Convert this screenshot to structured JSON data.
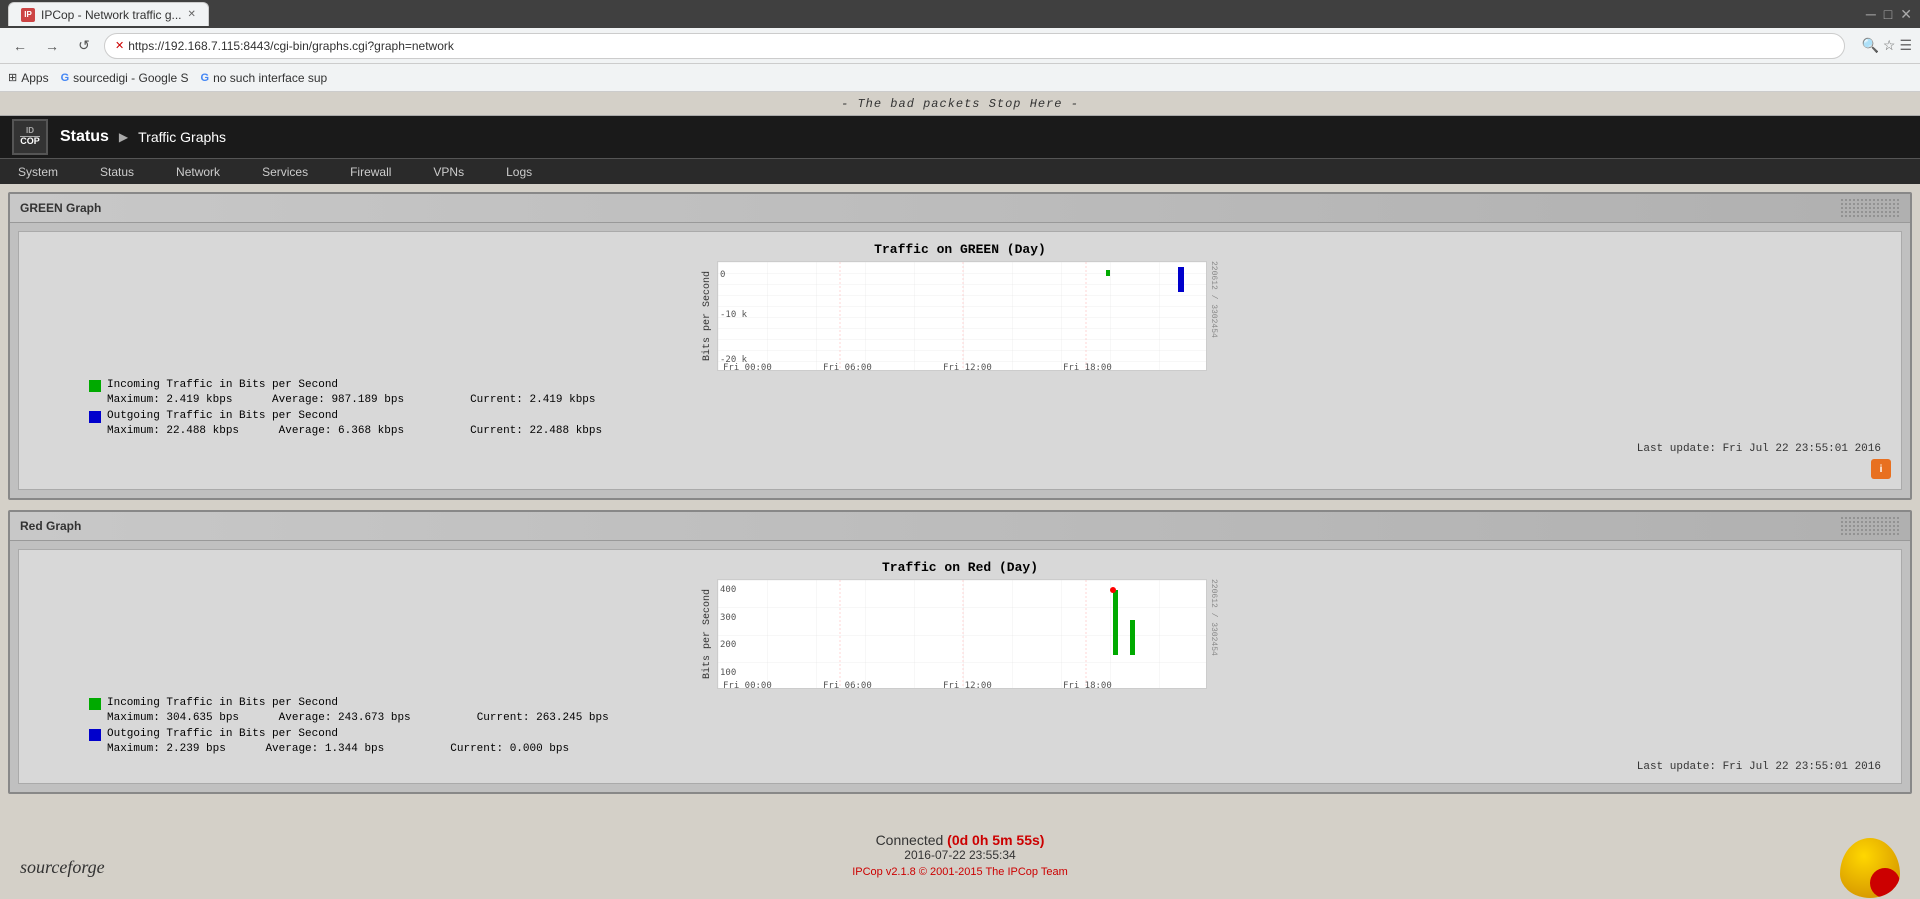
{
  "browser": {
    "tab_title": "IPCop - Network traffic g...",
    "url": "https://192.168.7.115:8443/cgi-bin/graphs.cgi?graph=network",
    "bookmarks": [
      "Apps",
      "sourcedigi - Google S",
      "no such interface sup"
    ],
    "back_btn": "←",
    "forward_btn": "→",
    "refresh_btn": "↺"
  },
  "banner": {
    "text": "- The bad packets Stop Here -"
  },
  "ipcop": {
    "logo": "ID COP",
    "status": "Status",
    "arrow": "▶",
    "nav_title": "Traffic Graphs",
    "nav_items": [
      "System",
      "Status",
      "Network",
      "Services",
      "Firewall",
      "VPNs",
      "Logs"
    ]
  },
  "green_graph": {
    "section_title": "GREEN Graph",
    "chart_title": "Traffic on GREEN (Day)",
    "y_label": "Bits per Second",
    "x_labels": [
      "Fri 00:00",
      "Fri 06:00",
      "Fri 12:00",
      "Fri 18:00"
    ],
    "y_values": [
      "0",
      "-10 k",
      "-20 k"
    ],
    "incoming_label": "Incoming Traffic in Bits per Second",
    "incoming_color": "#00aa00",
    "incoming_max": "Maximum:  2.419 kbps",
    "incoming_avg": "Average: 987.189  bps",
    "incoming_cur": "Current:    2.419 kbps",
    "outgoing_label": "Outgoing Traffic in Bits per Second",
    "outgoing_color": "#0000cc",
    "outgoing_max": "Maximum: 22.488 kbps",
    "outgoing_avg": "Average:  6.368 kbps",
    "outgoing_cur": "Current:   22.488 kbps",
    "last_update": "Last update: Fri Jul 22 23:55:01 2016"
  },
  "red_graph": {
    "section_title": "Red Graph",
    "chart_title": "Traffic on Red (Day)",
    "y_label": "Bits per Second",
    "x_labels": [
      "Fri 00:00",
      "Fri 06:00",
      "Fri 12:00",
      "Fri 18:00"
    ],
    "y_values": [
      "400",
      "300",
      "200",
      "100"
    ],
    "incoming_label": "Incoming Traffic in Bits per Second",
    "incoming_color": "#00aa00",
    "incoming_max": "Maximum: 304.635  bps",
    "incoming_avg": "Average: 243.673  bps",
    "incoming_cur": "Current:  263.245  bps",
    "outgoing_label": "Outgoing Traffic in Bits per Second",
    "outgoing_color": "#0000cc",
    "outgoing_max": "Maximum:   2.239  bps",
    "outgoing_avg": "Average:   1.344  bps",
    "outgoing_cur": "Current:   0.000  bps",
    "last_update": "Last update: Fri Jul 22 23:55:01 2016"
  },
  "footer": {
    "connected_label": "Connected",
    "connected_time": "(0d 0h 5m 55s)",
    "datetime": "2016-07-22 23:55:34",
    "ipcop_version": "IPCop v2.1.8 © 2001-2015 The IPCop Team",
    "sourceforge": "sourceforge"
  }
}
